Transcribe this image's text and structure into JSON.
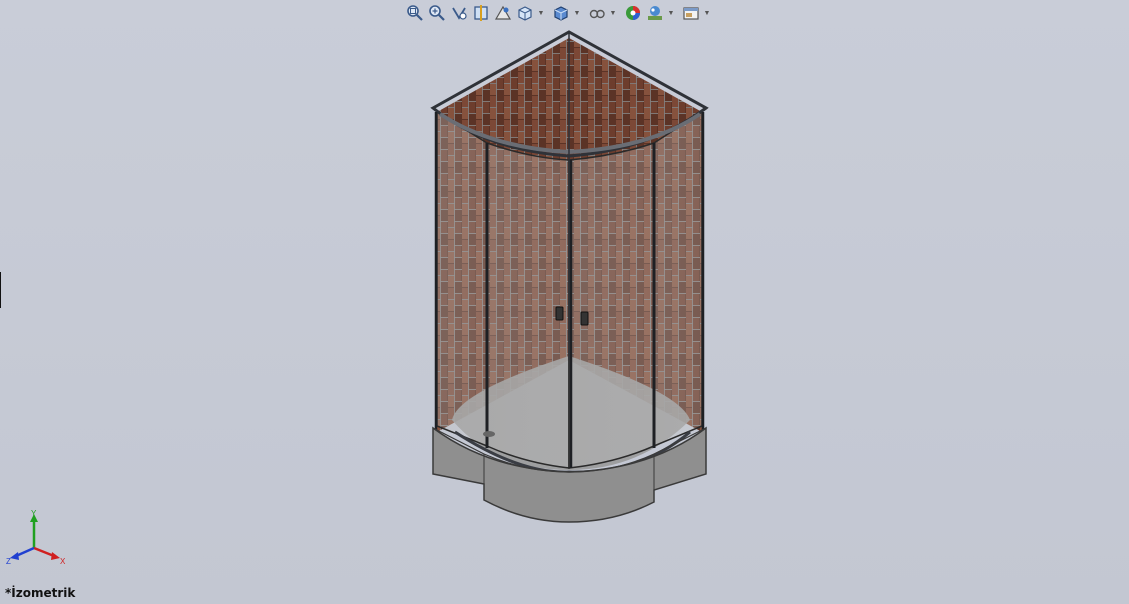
{
  "viewport": {
    "view_label": "*İzometrik",
    "background_color": "#c6cad5"
  },
  "toolbar": {
    "buttons": [
      {
        "name": "zoom-to-fit-icon",
        "dropdown": false
      },
      {
        "name": "zoom-to-area-icon",
        "dropdown": false
      },
      {
        "name": "previous-view-icon",
        "dropdown": false
      },
      {
        "name": "section-view-icon",
        "dropdown": false
      },
      {
        "name": "dynamic-annotation-icon",
        "dropdown": false
      },
      {
        "name": "view-orientation-icon",
        "dropdown": true
      },
      {
        "name": "display-style-icon",
        "dropdown": true
      },
      {
        "name": "hide-show-items-icon",
        "dropdown": true
      },
      {
        "name": "edit-appearance-icon",
        "dropdown": false
      },
      {
        "name": "apply-scene-icon",
        "dropdown": true
      },
      {
        "name": "view-settings-icon",
        "dropdown": true
      }
    ]
  },
  "triad": {
    "x_label": "X",
    "y_label": "Y",
    "z_label": "Z",
    "x_color": "#d02020",
    "y_color": "#20a020",
    "z_color": "#2040d0"
  },
  "model": {
    "description_icon": "shower-cabin-model",
    "brick_color": "#6b3a2a",
    "frame_color": "#3a3d44",
    "tray_color": "#8a8a8a"
  }
}
